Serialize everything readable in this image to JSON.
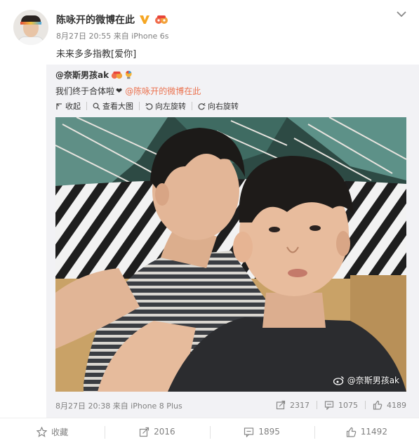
{
  "post": {
    "author": "陈咏开的微博在此",
    "meta": "8月27日 20:55 来自 iPhone 6s",
    "text": "未来多多指教[爱你]"
  },
  "repost": {
    "author": "@奈斯男孩ak",
    "text": "我们终于合体啦",
    "mention": "@陈咏开的微博在此",
    "toolbar": {
      "collapse": "收起",
      "view_large": "查看大图",
      "rotate_left": "向左旋转",
      "rotate_right": "向右旋转"
    },
    "watermark": "@奈斯男孩ak",
    "meta": "8月27日 20:38 来自 iPhone 8 Plus",
    "stats": {
      "shares": "2317",
      "comments": "1075",
      "likes": "4189"
    }
  },
  "actions": {
    "favorite": "收藏",
    "shares": "2016",
    "comments": "1895",
    "likes": "11492"
  },
  "colors": {
    "accent": "#eb7350",
    "verified": "#f5a623",
    "meta": "#808080"
  }
}
